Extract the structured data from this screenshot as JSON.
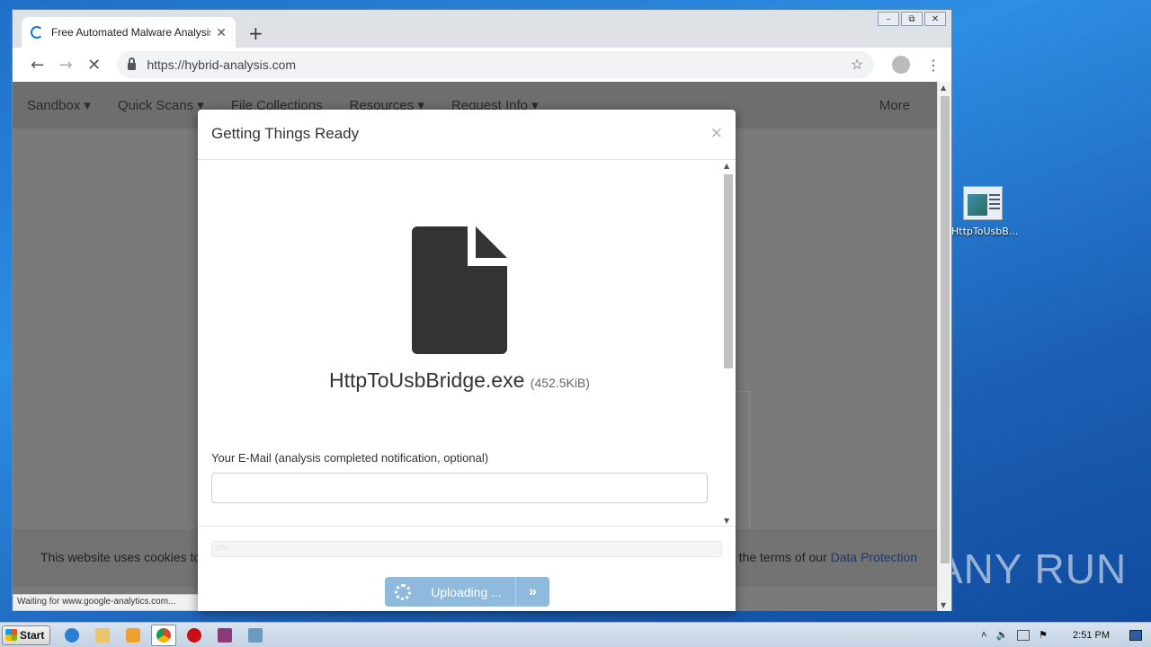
{
  "browser": {
    "tab_title": "Free Automated Malware Analysis S…",
    "url": "https://hybrid-analysis.com",
    "status_text": "Waiting for www.google-analytics.com..."
  },
  "site": {
    "nav": [
      "Sandbox",
      "Quick Scans",
      "File Collections",
      "Resources",
      "Request Info"
    ],
    "nav_more": "More",
    "cookie_left": "This website uses cookies to",
    "cookie_right": "o the terms of our",
    "cookie_link": "Data Protection"
  },
  "modal": {
    "title": "Getting Things Ready",
    "close": "×",
    "filename": "HttpToUsbBridge.exe",
    "filesize": "(452.5KiB)",
    "email_label": "Your E-Mail (analysis completed notification, optional)",
    "email_value": "",
    "progress_label": "0%",
    "progress": 0,
    "upload_label": "Uploading ..."
  },
  "desktop": {
    "icon_label": "HttpToUsbB...",
    "watermark": "ANY RUN"
  },
  "taskbar": {
    "start_label": "Start",
    "clock": "2:51 PM"
  },
  "colors": {
    "upload_button": "#8fb9dd",
    "overlay": "#7a7a7a",
    "desktop": "#2d8ee3"
  }
}
